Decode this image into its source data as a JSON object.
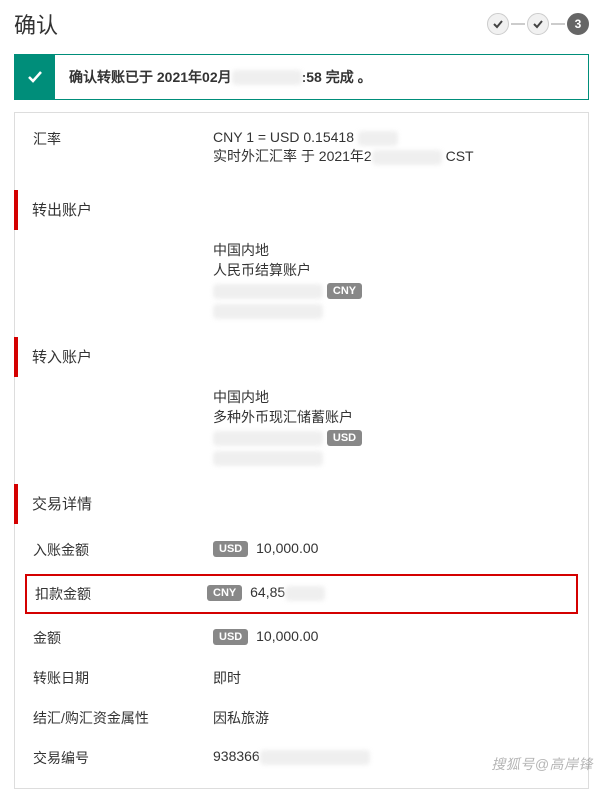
{
  "header": {
    "title": "确认",
    "step_current": "3"
  },
  "alert": {
    "prefix": "确认转账已于 2021年02月",
    "suffix": ":58 完成 。"
  },
  "rate": {
    "label": "汇率",
    "line1": "CNY 1 = USD 0.15418",
    "line2_prefix": "实时外汇汇率 于 2021年2",
    "line2_suffix": " CST"
  },
  "from": {
    "header": "转出账户",
    "region": "中国内地",
    "acct": "人民币结算账户",
    "badge": "CNY"
  },
  "to": {
    "header": "转入账户",
    "region": "中国内地",
    "acct": "多种外币现汇储蓄账户",
    "badge": "USD"
  },
  "details": {
    "header": "交易详情",
    "credit_label": "入账金额",
    "credit_badge": "USD",
    "credit_value": "10,000.00",
    "debit_label": "扣款金额",
    "debit_badge": "CNY",
    "debit_value_prefix": "64,85",
    "amount_label": "金额",
    "amount_badge": "USD",
    "amount_value": "10,000.00",
    "date_label": "转账日期",
    "date_value": "即时",
    "purpose_label": "结汇/购汇资金属性",
    "purpose_value": "因私旅游",
    "ref_label": "交易编号",
    "ref_value_prefix": "938366"
  },
  "watermark": "搜狐号@高岸锋"
}
